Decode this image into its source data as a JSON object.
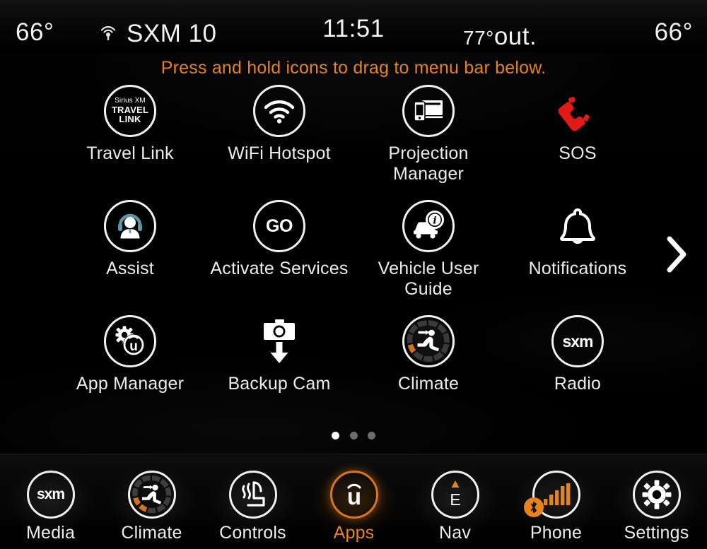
{
  "status_bar": {
    "left_temp": "66°",
    "antenna_icon": "antenna-signal-icon",
    "source": "SXM 10",
    "clock": "11:51",
    "outside_temp": "77°",
    "outside_suffix": "out.",
    "right_temp": "66°"
  },
  "hint": "Press and hold icons to drag to menu bar below.",
  "colors": {
    "accent": "#e8821a",
    "text": "#ececec",
    "background": "#000000",
    "sos_red": "#e01b17",
    "bluetooth_badge": "#e8821a"
  },
  "apps": [
    {
      "label": "Travel Link",
      "icon": "sirius-xm-travel-link-icon",
      "badge_lines": [
        "Sirius XM",
        "TRAVEL",
        "LINK"
      ]
    },
    {
      "label": "WiFi Hotspot",
      "icon": "wifi-hotspot-icon"
    },
    {
      "label": "Projection\nManager",
      "icon": "projection-manager-icon"
    },
    {
      "label": "SOS",
      "icon": "sos-phone-icon"
    },
    {
      "label": "Assist",
      "icon": "assist-headset-person-icon"
    },
    {
      "label": "Activate Services",
      "icon": "activate-services-go-icon",
      "badge_text": "GO"
    },
    {
      "label": "Vehicle User\nGuide",
      "icon": "vehicle-user-guide-icon"
    },
    {
      "label": "Notifications",
      "icon": "notifications-bell-icon"
    },
    {
      "label": "App Manager",
      "icon": "app-manager-uconnect-gear-icon"
    },
    {
      "label": "Backup Cam",
      "icon": "backup-cam-camera-icon"
    },
    {
      "label": "Climate",
      "icon": "climate-dial-icon"
    },
    {
      "label": "Radio",
      "icon": "sxm-radio-icon",
      "badge_text": "sxm"
    }
  ],
  "page_arrow": {
    "icon": "chevron-right-icon"
  },
  "pagination": {
    "total": 3,
    "active_index": 0
  },
  "menu_bar": [
    {
      "label": "Media",
      "icon": "sxm-media-icon",
      "badge_text": "sxm",
      "active": false
    },
    {
      "label": "Climate",
      "icon": "climate-dial-icon",
      "active": false
    },
    {
      "label": "Controls",
      "icon": "heated-seat-icon",
      "active": false
    },
    {
      "label": "Apps",
      "icon": "uconnect-apps-icon",
      "active": true
    },
    {
      "label": "Nav",
      "icon": "nav-compass-icon",
      "badge_text": "E",
      "active": false
    },
    {
      "label": "Phone",
      "icon": "phone-signal-bars-icon",
      "bluetooth_badge": "bluetooth-icon",
      "active": false
    },
    {
      "label": "Settings",
      "icon": "settings-gear-icon",
      "active": false
    }
  ]
}
